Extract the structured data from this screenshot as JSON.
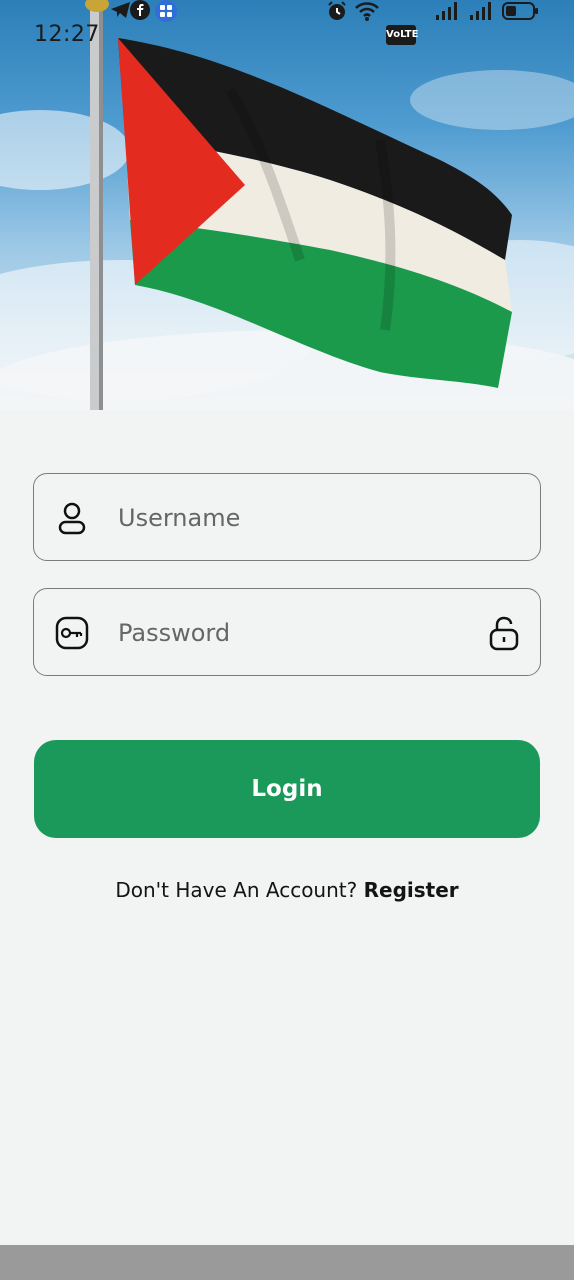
{
  "status_bar": {
    "time": "12:27",
    "network_label": "VoLTE"
  },
  "login_form": {
    "username_placeholder": "Username",
    "password_placeholder": "Password",
    "login_label": "Login",
    "register_prompt": "Don't Have An Account?",
    "register_label": "Register"
  },
  "colors": {
    "accent": "#1b995a",
    "background": "#f2f4f3",
    "flag_black": "#1a1a1a",
    "flag_white": "#f1ece2",
    "flag_green": "#1a9a4a",
    "flag_red": "#e42b20"
  },
  "icons": {
    "username": "user-icon",
    "password": "key-icon",
    "password_toggle": "unlock-icon"
  }
}
